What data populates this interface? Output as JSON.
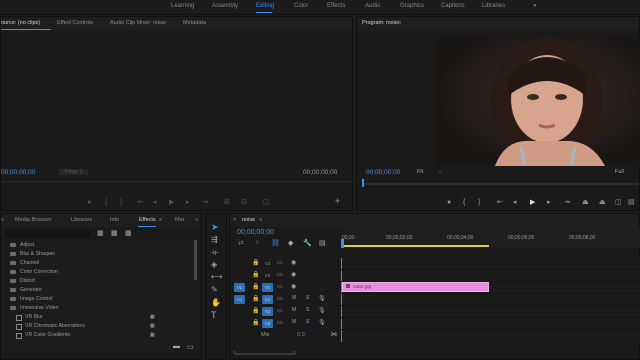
{
  "workspaces": [
    "Learning",
    "Assembly",
    "Editing",
    "Color",
    "Effects",
    "Audio",
    "Graphics",
    "Captions",
    "Libraries"
  ],
  "workspace_active": "Editing",
  "workspace_more": "»",
  "source_panel": {
    "tabs": [
      "ource: (no clips)",
      "Effect Controls",
      "Audio Clip Mixer: noise",
      "Metadata"
    ],
    "menu_icon": "≡",
    "timecode_left": "00;00;00;00",
    "fit_label": "Fit",
    "page_label": "Page 1",
    "timecode_right": "00;00;00;00",
    "add_button": "+"
  },
  "program_panel": {
    "title": "Program: noise",
    "menu_icon": "≡",
    "timecode_left": "00;00;00;00",
    "fit_label": "Fit",
    "quality_label": "Full",
    "add_button": "+"
  },
  "effects_panel": {
    "more": "»",
    "tabs": [
      "Media Browser",
      "Libraries",
      "Info",
      "Effects",
      "Mar"
    ],
    "active_tab": "Effects",
    "menu_icon": "≡",
    "tree": [
      {
        "label": "Adjust",
        "type": "folder",
        "indent": 1
      },
      {
        "label": "Blur & Sharpen",
        "type": "folder",
        "indent": 1
      },
      {
        "label": "Channel",
        "type": "folder",
        "indent": 1
      },
      {
        "label": "Color Correction",
        "type": "folder",
        "indent": 1
      },
      {
        "label": "Distort",
        "type": "folder",
        "indent": 1
      },
      {
        "label": "Generate",
        "type": "folder",
        "indent": 1
      },
      {
        "label": "Image Control",
        "type": "folder",
        "indent": 1
      },
      {
        "label": "Immersive Video",
        "type": "folder-open",
        "indent": 1
      },
      {
        "label": "VR Blur",
        "type": "effect",
        "indent": 2
      },
      {
        "label": "VR Chromatic Aberrations",
        "type": "effect",
        "indent": 2
      },
      {
        "label": "VR Color Gradients",
        "type": "effect",
        "indent": 2
      }
    ]
  },
  "timeline": {
    "close": "×",
    "sequence_name": "noise",
    "menu_icon": "≡",
    "timecode": "00;00;00;00",
    "ruler": [
      "00;00",
      "00;00;02;00",
      "00;00;04;00",
      "00;00;06;00",
      "00;00;08;00"
    ],
    "tracks": [
      {
        "name": "V3",
        "target": ""
      },
      {
        "name": "V2",
        "target": ""
      },
      {
        "name": "V1",
        "target": "V1"
      },
      {
        "name": "A1",
        "target": "A1"
      },
      {
        "name": "A2",
        "target": ""
      },
      {
        "name": "A3",
        "target": ""
      }
    ],
    "mix_label": "Mix",
    "mix_value": "0.0",
    "clip_label": "noise.jpg"
  },
  "colors": {
    "accent": "#3d8ff0",
    "clip": "#e88ee0"
  }
}
